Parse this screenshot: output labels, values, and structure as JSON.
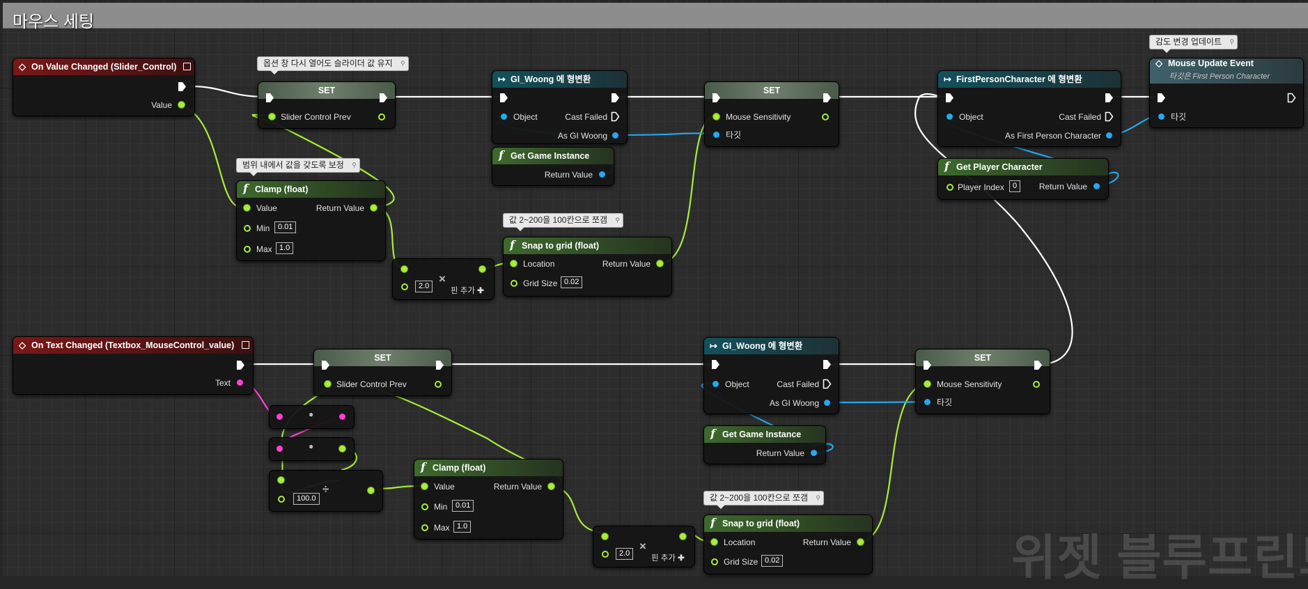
{
  "graph": {
    "comment_title": "마우스 세팅",
    "watermark": "위젯 블루프린트"
  },
  "colors": {
    "exec_wire": "#ffffff",
    "float_pin": "#a6ee38",
    "object_pin": "#25a8ee",
    "text_pin": "#ff41cf",
    "event_header": "#7a1818",
    "cast_header": "#13515c",
    "function_header": "#3d6a2c"
  },
  "comments": {
    "slider_keep": "옵션 창 다시 열어도 슬라이더 값 유지",
    "clamp_note": "범위 내에서 값을 갖도록 보정",
    "snap_note_top": "값 2~200을 100칸으로 쪼갬",
    "update_note": "감도 변경 업데이트",
    "snap_note_bottom": "값 2~200을 100칸으로 쪼갬"
  },
  "nodes": {
    "on_value_changed": {
      "title": "On Value Changed (Slider_Control)",
      "value": "Value"
    },
    "set_prev_top": {
      "title": "SET",
      "var": "Slider Control Prev"
    },
    "cast_gi_top": {
      "title": "GI_Woong 에 형변환",
      "object": "Object",
      "cast_failed": "Cast Failed",
      "as_gi": "As GI Woong"
    },
    "get_game_instance_top": {
      "title": "Get Game Instance",
      "ret": "Return Value"
    },
    "set_sens_top": {
      "title": "SET",
      "var": "Mouse Sensitivity",
      "target": "타깃"
    },
    "cast_fpc": {
      "title": "FirstPersonCharacter 에 형변환",
      "object": "Object",
      "cast_failed": "Cast Failed",
      "as_fpc": "As First Person Character"
    },
    "get_player_character": {
      "title": "Get Player Character",
      "player_index": "Player Index",
      "player_index_val": "0",
      "ret": "Return Value"
    },
    "mouse_update": {
      "title": "Mouse Update Event",
      "subtitle": "타깃은 First Person Character",
      "target": "타깃"
    },
    "clamp_top": {
      "title": "Clamp (float)",
      "value": "Value",
      "ret": "Return Value",
      "min": "Min",
      "min_val": "0.01",
      "max": "Max",
      "max_val": "1.0"
    },
    "multiply_top": {
      "val": "2.0",
      "add_pin": "핀 추가"
    },
    "snap_top": {
      "title": "Snap to grid (float)",
      "location": "Location",
      "ret": "Return Value",
      "grid": "Grid Size",
      "grid_val": "0.02"
    },
    "on_text_changed": {
      "title": "On Text Changed (Textbox_MouseControl_value)",
      "text": "Text"
    },
    "set_prev_bottom": {
      "title": "SET",
      "var": "Slider Control Prev"
    },
    "cast_gi_bottom": {
      "title": "GI_Woong 에 형변환",
      "object": "Object",
      "cast_failed": "Cast Failed",
      "as_gi": "As GI Woong"
    },
    "get_game_instance_bottom": {
      "title": "Get Game Instance",
      "ret": "Return Value"
    },
    "set_sens_bottom": {
      "title": "SET",
      "var": "Mouse Sensitivity",
      "target": "타깃"
    },
    "divide_bottom": {
      "val": "100.0"
    },
    "clamp_bottom": {
      "title": "Clamp (float)",
      "value": "Value",
      "ret": "Return Value",
      "min": "Min",
      "min_val": "0.01",
      "max": "Max",
      "max_val": "1.0"
    },
    "multiply_bottom": {
      "val": "2.0",
      "add_pin": "핀 추가"
    },
    "snap_bottom": {
      "title": "Snap to grid (float)",
      "location": "Location",
      "ret": "Return Value",
      "grid": "Grid Size",
      "grid_val": "0.02"
    }
  }
}
